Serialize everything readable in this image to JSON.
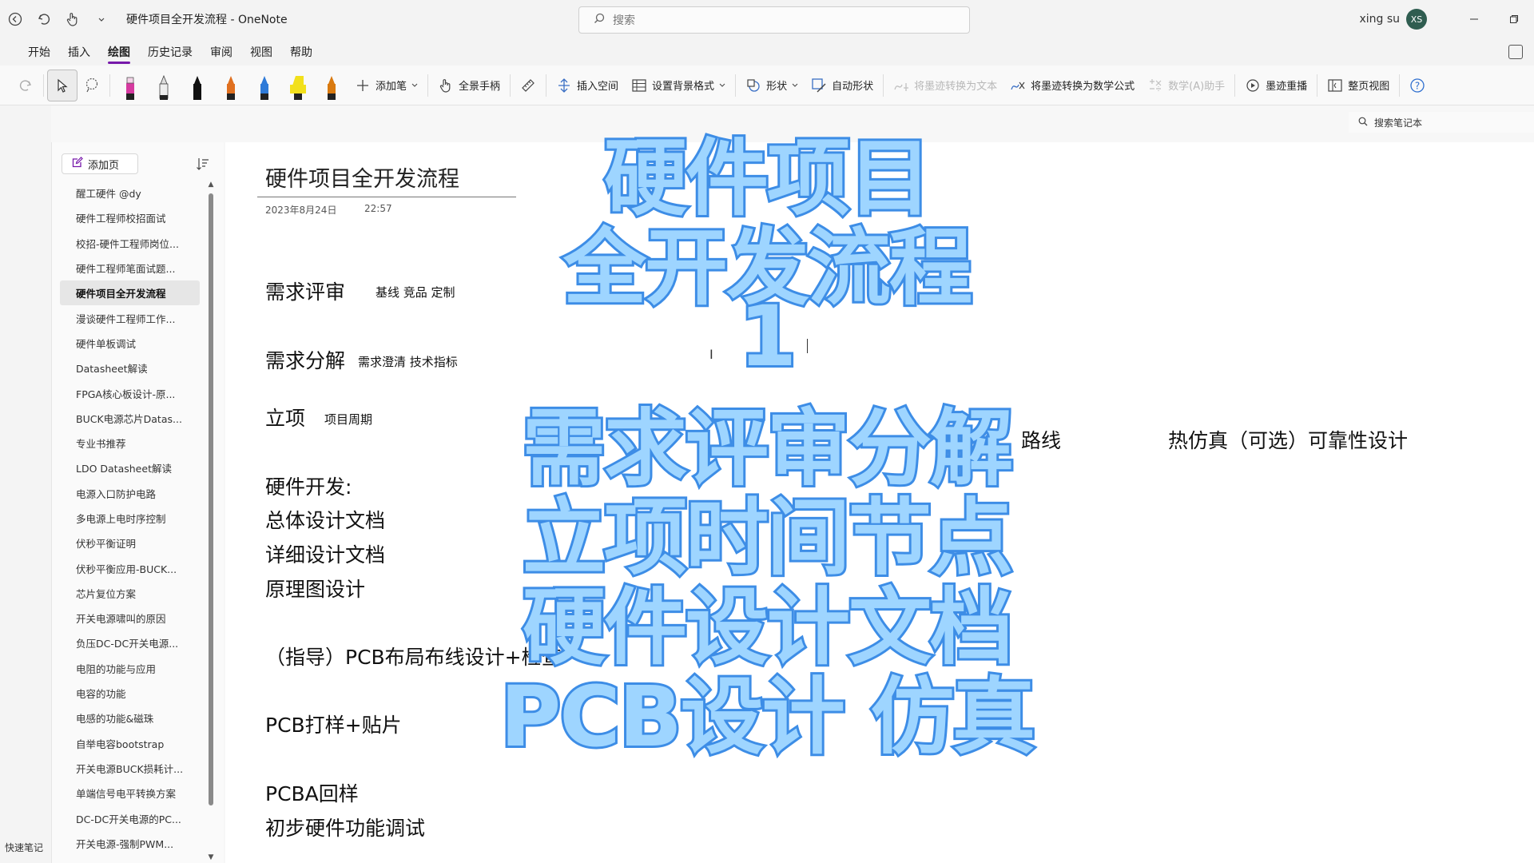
{
  "window": {
    "title": "硬件项目全开发流程  -  OneNote",
    "search_placeholder": "搜索",
    "user_name": "xing su",
    "user_initials": "XS"
  },
  "menu": {
    "tabs": [
      "开始",
      "插入",
      "绘图",
      "历史记录",
      "审阅",
      "视图",
      "帮助"
    ],
    "active_tab": "绘图"
  },
  "ribbon": {
    "add_pen": "添加笔",
    "full_hand": "全景手柄",
    "insert_space": "插入空间",
    "bg_format": "设置背景格式",
    "shapes": "形状",
    "auto_shape": "自动形状",
    "ink_to_text": "将墨迹转换为文本",
    "ink_to_math": "将墨迹转换为数学公式",
    "math_helper": "数学(A)助手",
    "ink_replay": "墨迹重播",
    "page_view": "整页视图",
    "pen_colors": [
      "#d63aa0",
      "#222222",
      "#111111",
      "#e07020",
      "#2f7bd8",
      "#f2e01c",
      "#d97a10"
    ]
  },
  "notebook_search": "搜索笔记本",
  "quick_notes": "快速笔记",
  "sidebar": {
    "add_page": "添加页",
    "pages": [
      "醒工硬件 @dy",
      "硬件工程师校招面试",
      "校招-硬件工程师岗位...",
      "硬件工程师笔面试题...",
      "硬件项目全开发流程",
      "漫谈硬件工程师工作...",
      "硬件单板调试",
      "Datasheet解读",
      "FPGA核心板设计-原...",
      "BUCK电源芯片Datas...",
      "专业书推荐",
      "LDO Datasheet解读",
      "电源入口防护电路",
      "多电源上电时序控制",
      "伏秒平衡证明",
      "伏秒平衡应用-BUCK...",
      "芯片复位方案",
      "开关电源啸叫的原因",
      "负压DC-DC开关电源...",
      "电阻的功能与应用",
      "电容的功能",
      "电感的功能&磁珠",
      "自举电容bootstrap",
      "开关电源BUCK损耗计...",
      "单端信号电平转换方案",
      "DC-DC开关电源的PC...",
      "开关电源-强制PWM..."
    ],
    "selected_index": 4
  },
  "page": {
    "title": "硬件项目全开发流程",
    "date": "2023年8月24日",
    "time": "22:57",
    "notes": {
      "req_review": "需求评审",
      "req_review_tags": "基线 竞品 定制",
      "req_decompose": "需求分解",
      "req_decompose_tags": "需求澄清 技术指标",
      "project_setup": "立项",
      "project_setup_tags": "项目周期",
      "hw_dev": "硬件开发:",
      "overall_doc": "总体设计文档",
      "detail_doc": "详细设计文档",
      "schematic": "原理图设计",
      "pcb_layout": "（指导）PCB布局布线设计+检查",
      "pcb_proof": "PCB打样+贴片",
      "pcba_return": "PCBA回样",
      "initial_debug": "初步硬件功能调试",
      "route_fragment": "路线",
      "thermal": "热仿真（可选）可靠性设计"
    }
  },
  "overlay": {
    "lines": [
      "硬件项目",
      "全开发流程",
      "1",
      "需求评审分解",
      "立项时间节点",
      "硬件设计文档",
      "PCB设计 仿真"
    ],
    "fill_color": "#9ed5ff",
    "stroke_color": "#3d8de6"
  }
}
